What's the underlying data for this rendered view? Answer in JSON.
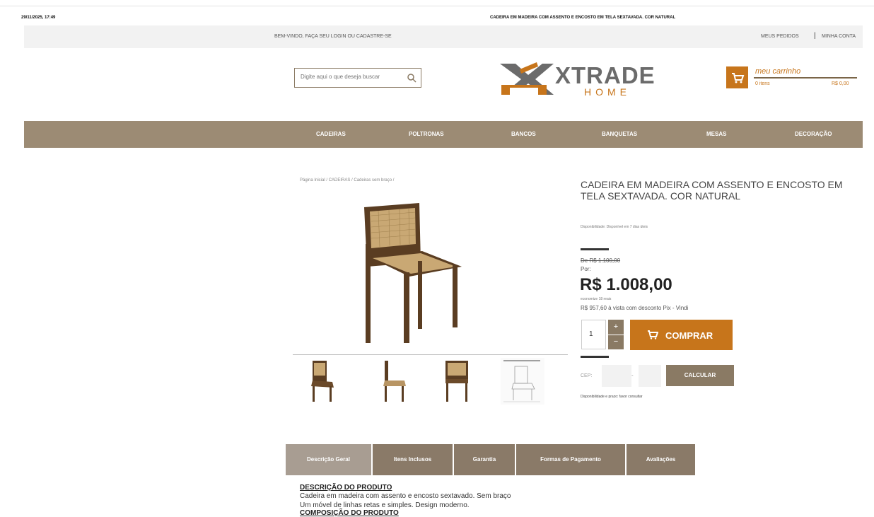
{
  "print_header": {
    "date": "29/11/2025, 17:49",
    "title": "CADEIRA EM MADEIRA COM ASSENTO E ENCOSTO EM TELA SEXTAVADA. COR NATURAL"
  },
  "top_bar": {
    "welcome": "BEM-VINDO, FAÇA SEU LOGIN OU CADASTRE-SE",
    "my_orders": "MEUS PEDIDOS",
    "separator": "|",
    "my_account": "MINHA CONTA"
  },
  "search": {
    "placeholder": "Digite aqui o que deseja buscar",
    "icon": "search-icon"
  },
  "logo": {
    "word": "XTRADE",
    "sub": "HOME"
  },
  "cart": {
    "label": "meu carrinho",
    "items": "0 itens",
    "total": "R$ 0,00",
    "icon": "cart-icon"
  },
  "nav": {
    "items": [
      {
        "label": "CADEIRAS"
      },
      {
        "label": "POLTRONAS"
      },
      {
        "label": "BANCOS"
      },
      {
        "label": "BANQUETAS"
      },
      {
        "label": "MESAS"
      },
      {
        "label": "DECORAÇÃO"
      }
    ]
  },
  "breadcrumb": "Página Inicial / CADEIRAS / Cadeiras sem braço /",
  "product": {
    "title": "CADEIRA EM MADEIRA COM ASSENTO E ENCOSTO EM TELA SEXTAVADA. COR NATURAL",
    "availability": "Disponibilidade: Disponível em 7 dias úteis",
    "old_price": "De R$ 1.100,00",
    "por": "Por:",
    "price": "R$ 1.008,00",
    "price_note": "economize 18 reais",
    "pix": "R$ 957,60 à vista com desconto Pix - Vindi",
    "quantity": "1",
    "buy_label": "COMPRAR",
    "plus": "+",
    "minus": "−"
  },
  "shipping": {
    "cep_label": "CEP:",
    "dash": "-",
    "calc_label": "CALCULAR",
    "note": "Disponibilidade e prazo: favor consultar"
  },
  "tabs": [
    {
      "label": "Descrição Geral"
    },
    {
      "label": "Itens Inclusos"
    },
    {
      "label": "Garantia"
    },
    {
      "label": "Formas de Pagamento"
    },
    {
      "label": "Avaliações"
    }
  ],
  "description": {
    "title": "DESCRIÇÃO DO PRODUTO",
    "line1": "Cadeira em madeira com assento e encosto sextavado. Sem braço",
    "line2": "Um móvel de linhas retas e simples. Design moderno.",
    "line3": "COMPOSIÇÃO DO PRODUTO"
  },
  "colors": {
    "accent": "#c7751b",
    "nav_bg": "#9c8b74",
    "button_brown": "#8a7a64",
    "tab_active": "#a89d92",
    "tab_inactive": "#8a7a68"
  }
}
